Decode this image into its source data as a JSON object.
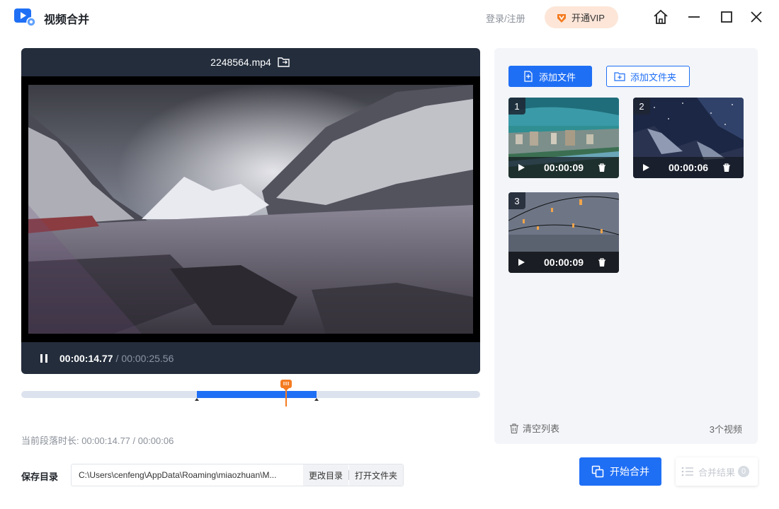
{
  "app": {
    "title": "视频合并"
  },
  "header": {
    "login": "登录/注册",
    "vip": "开通VIP"
  },
  "player": {
    "filename": "2248564.mp4",
    "current_time": "00:00:14.77",
    "separator": "/",
    "duration": "00:00:25.56"
  },
  "segment": {
    "text": "当前段落时长: 00:00:14.77 / 00:00:06"
  },
  "save": {
    "label": "保存目录",
    "path": "C:\\Users\\cenfeng\\AppData\\Roaming\\miaozhuan\\M...",
    "change_dir": "更改目录",
    "open_folder": "打开文件夹"
  },
  "files": {
    "add_file": "添加文件",
    "add_folder": "添加文件夹",
    "clear": "清空列表",
    "count": "3个视频",
    "items": [
      {
        "index": "1",
        "duration": "00:00:09"
      },
      {
        "index": "2",
        "duration": "00:00:06"
      },
      {
        "index": "3",
        "duration": "00:00:09"
      }
    ]
  },
  "actions": {
    "start_merge": "开始合并",
    "merge_result": "合并结果",
    "result_count": "0"
  },
  "colors": {
    "accent": "#1f6ff5",
    "playhead": "#f47b20",
    "player_bg": "#232d3c"
  }
}
